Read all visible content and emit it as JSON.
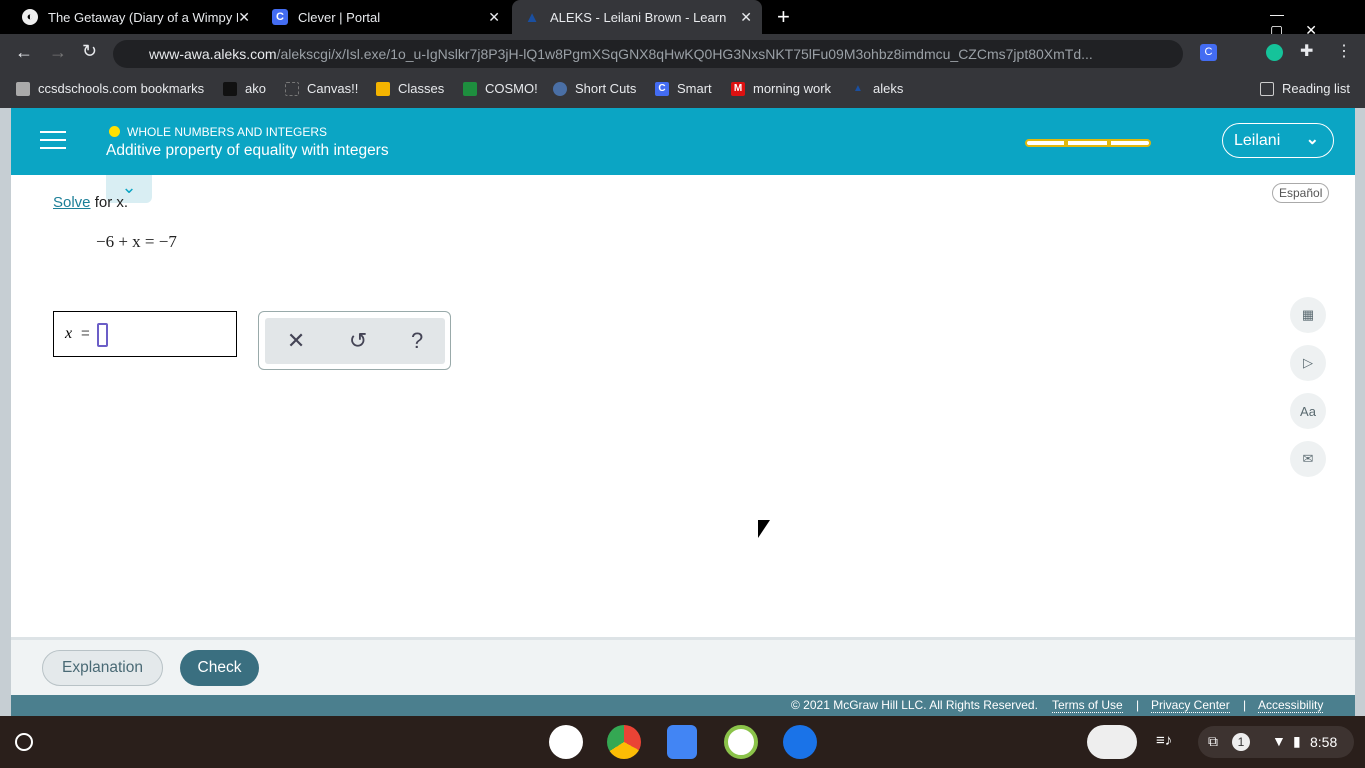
{
  "browser": {
    "tabs": [
      {
        "title": "The Getaway (Diary of a Wimpy K",
        "icon": "globe-icon"
      },
      {
        "title": "Clever | Portal",
        "icon": "clever-icon"
      },
      {
        "title": "ALEKS - Leilani Brown - Learn",
        "icon": "aleks-icon",
        "active": true
      }
    ],
    "url_domain": "www-awa.aleks.com",
    "url_path": "/alekscgi/x/Isl.exe/1o_u-IgNslkr7j8P3jH-lQ1w8PgmXSqGNX8qHwKQ0HG3NxsNKT75lFu09M3ohbz8imdmcu_CZCms7jpt80XmTd...",
    "bookmarks": [
      "ccsdschools.com bookmarks",
      "ako",
      "Canvas!!",
      "Classes",
      "COSMO!",
      "Short Cuts",
      "Smart",
      "morning work",
      "aleks"
    ],
    "reading_list": "Reading list"
  },
  "aleks": {
    "category": "WHOLE NUMBERS AND INTEGERS",
    "topic": "Additive property of equality with integers",
    "progress_segments_filled": 0,
    "progress_segments_total": 3,
    "user": "Leilani",
    "language": "Español",
    "prompt_link": "Solve",
    "prompt_rest": " for x.",
    "equation": "−6 + x = −7",
    "answer_var": "x",
    "answer_eq": "=",
    "answer_value": "",
    "tools": [
      "close-icon",
      "undo-icon",
      "help-icon"
    ],
    "side_tools": [
      "calculator-icon",
      "video-icon",
      "dictionary-icon",
      "mail-icon"
    ],
    "explanation": "Explanation",
    "check": "Check",
    "copyright": "© 2021 McGraw Hill LLC. All Rights Reserved.",
    "footer_links": [
      "Terms of Use",
      "Privacy Center",
      "Accessibility"
    ],
    "accent": "#0ba5c4"
  },
  "taskbar": {
    "time": "8:58",
    "notifications": "1"
  }
}
